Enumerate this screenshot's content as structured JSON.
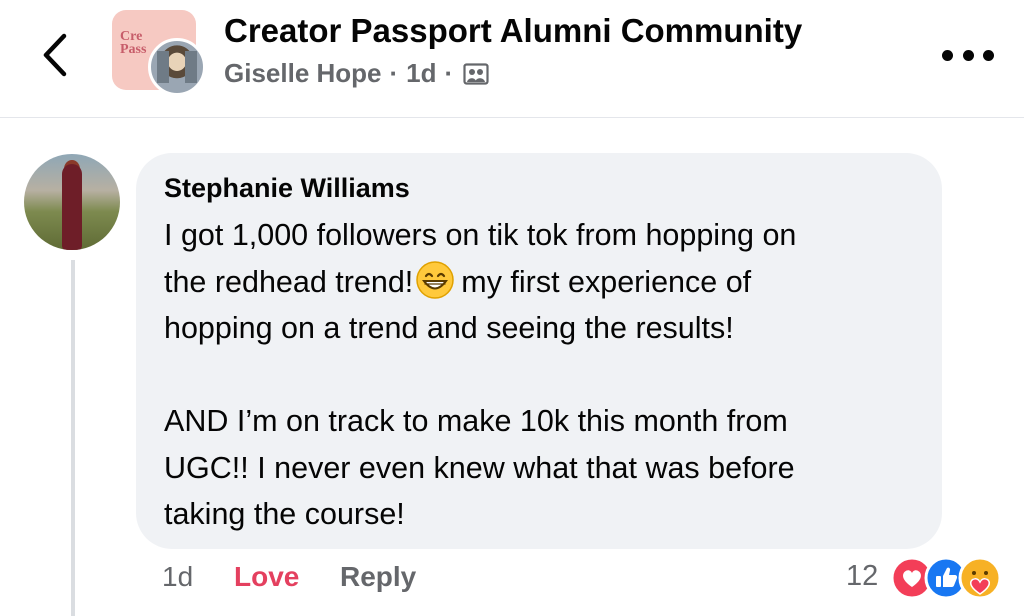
{
  "header": {
    "group_title": "Creator Passport Alumni Community",
    "author": "Giselle Hope",
    "separator": "·",
    "time": "1d",
    "group_thumb_text": "Cre\nPass",
    "icons": {
      "back": "chevron-left-icon",
      "privacy": "group-members-icon",
      "more": "more-options-icon"
    }
  },
  "comment": {
    "author": "Stephanie Williams",
    "lines": [
      "I got 1,000 followers on tik tok from hopping on",
      "the redhead trend!",
      "my first experience of",
      "hopping on a trend and seeing the results!",
      "AND I’m on track to make 10k this month from",
      "UGC!! I never even knew what that was before",
      "taking the course!"
    ],
    "emoji": "grinning-face-emoji"
  },
  "actions": {
    "time": "1d",
    "love": "Love",
    "reply": "Reply",
    "reaction_count": "12",
    "reactions": [
      "love-reaction-icon",
      "like-reaction-icon",
      "care-reaction-icon"
    ]
  },
  "colors": {
    "bubble": "#f0f2f5",
    "love": "#e4405f",
    "secondary_text": "#65676b",
    "like_blue": "#1877f2",
    "love_red": "#f33e58",
    "care_yellow": "#f7b125"
  }
}
